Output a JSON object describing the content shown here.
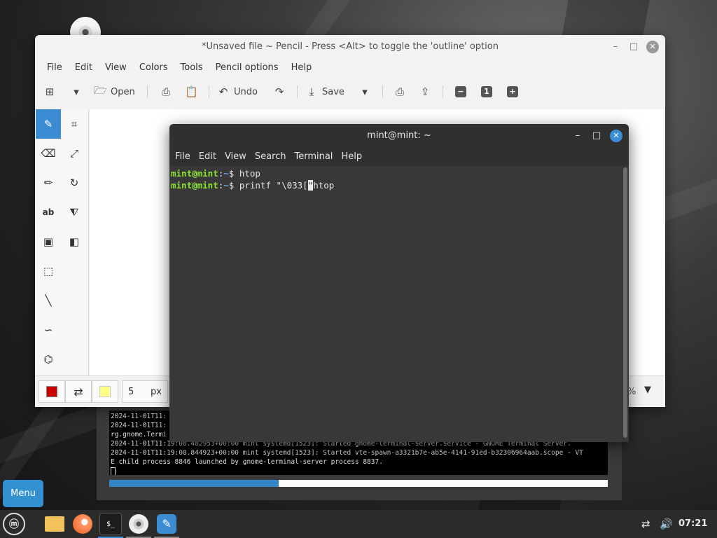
{
  "desktop": {
    "disc_icon": "disc-icon"
  },
  "pencil": {
    "title": "*Unsaved file ~ Pencil - Press <Alt> to toggle the 'outline' option",
    "menu": [
      "File",
      "Edit",
      "View",
      "Colors",
      "Tools",
      "Pencil options",
      "Help"
    ],
    "toolbar": {
      "open": "Open",
      "undo": "Undo",
      "save": "Save"
    },
    "size_value": "5",
    "size_unit": "px",
    "zoom_suffix": "%",
    "colors": {
      "main": "#cc0000",
      "secondary": "#ffff88",
      "accent": "#3c8cd3"
    }
  },
  "terminal": {
    "title": "mint@mint: ~",
    "menu": [
      "File",
      "Edit",
      "View",
      "Search",
      "Terminal",
      "Help"
    ],
    "lines": [
      {
        "user": "mint@mint",
        "path": "~",
        "cmd_before": "htop",
        "cursor": "",
        "cmd_after": ""
      },
      {
        "user": "mint@mint",
        "path": "~",
        "cmd_before": "printf \"\\033[",
        "cursor": "\"",
        "cmd_after": "htop"
      }
    ]
  },
  "log": {
    "lines": [
      "2024-11-01T11:",
      "2024-11-01T11:",
      "rg.gnome.Termi",
      "2024-11-01T11:19:08.482953+00:00 mint systemd[1523]: Started gnome-terminal-server.service - GNOME Terminal Server.",
      "2024-11-01T11:19:08.844923+00:00 mint systemd[1523]: Started vte-spawn-a3321b7e-ab5e-4141-91ed-b32306964aab.scope - VT",
      "E child process 8846 launched by gnome-terminal-server process 8837."
    ],
    "progress": 0.34
  },
  "menu_button": "Menu",
  "tray": {
    "time": "07:21"
  }
}
